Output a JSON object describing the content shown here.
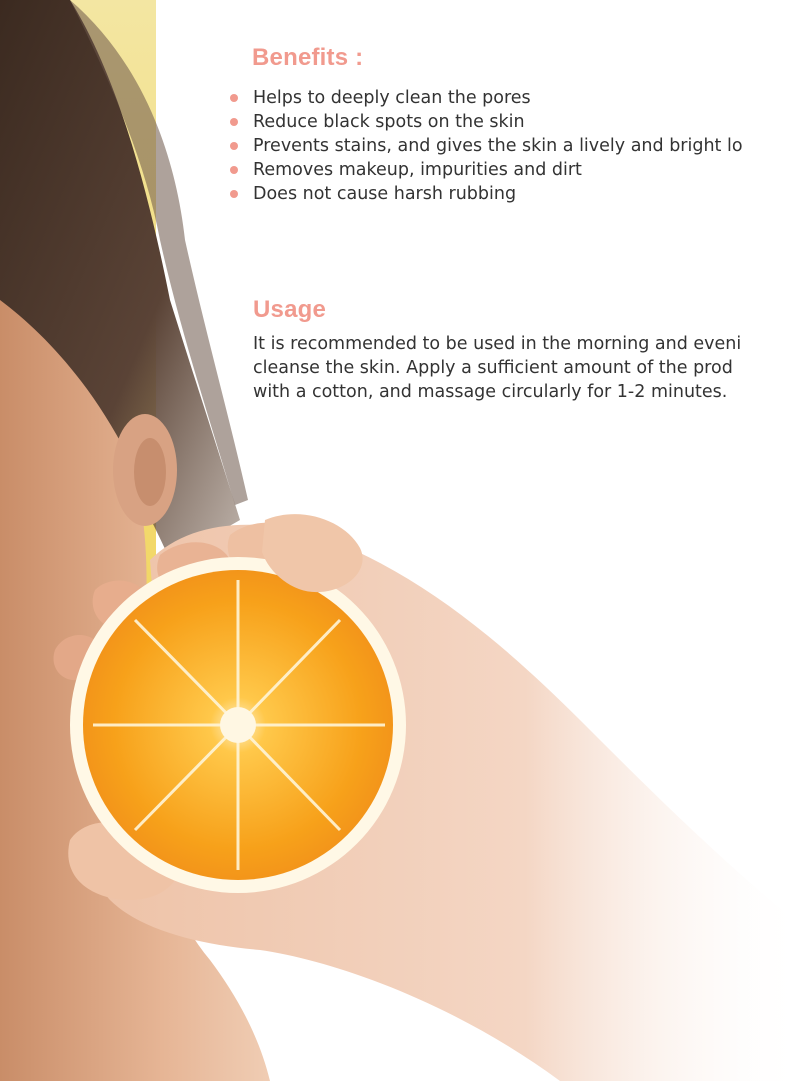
{
  "benefits": {
    "title": "Benefits :",
    "items": [
      "Helps to deeply clean the pores",
      "Reduce black spots on the skin",
      "Prevents stains, and gives the skin a lively and bright lo",
      "Removes makeup, impurities and dirt",
      "Does not cause harsh rubbing"
    ]
  },
  "usage": {
    "title": "Usage",
    "lines": [
      "It is recommended to be used in the morning and eveni",
      "cleanse the skin. Apply a sufficient amount of the prod",
      "with a cotton, and massage circularly for 1-2 minutes."
    ]
  },
  "colors": {
    "accent": "#f19a8e",
    "body_text": "#333333",
    "background": "#ffffff",
    "side_band": "#f2d86a",
    "orange": "#f5a21c"
  },
  "image": {
    "subject": "woman-holding-orange-half-photo"
  }
}
